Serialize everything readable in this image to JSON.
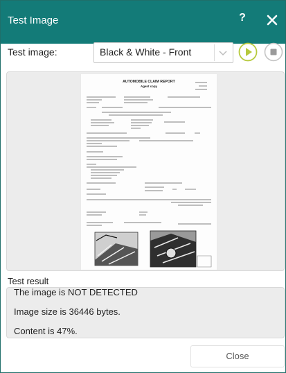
{
  "window": {
    "title": "Test Image",
    "help_label": "?"
  },
  "test_image": {
    "label": "Test image:",
    "selected_value": "Black & White - Front",
    "colors": {
      "play": "#b6c93c",
      "stop": "#9a9a9a"
    }
  },
  "preview": {
    "document_heading": "AUTOMOBILE CLAIM REPORT",
    "document_subheading": "Agent copy"
  },
  "result": {
    "label": "Test result",
    "lines": [
      "The image is NOT DETECTED",
      "Image size is 36446 bytes.",
      "Content is 47%."
    ]
  },
  "footer": {
    "close_label": "Close"
  },
  "colors": {
    "titlebar": "#137b78",
    "panel": "#ececec"
  }
}
